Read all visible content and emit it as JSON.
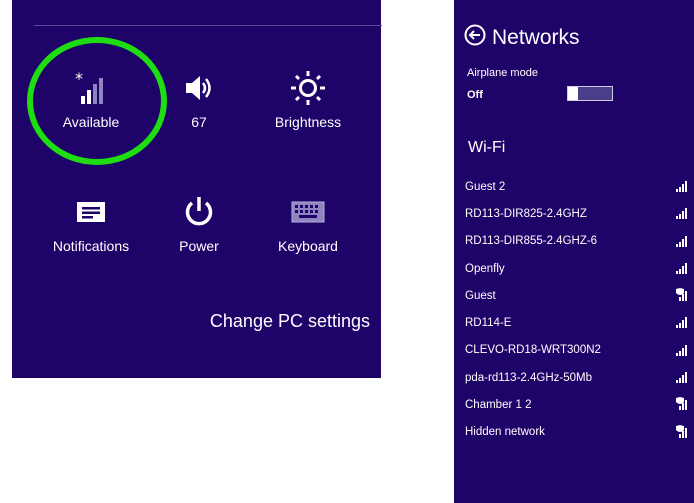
{
  "settings": {
    "quick_actions": [
      {
        "label": "Available",
        "icon": "wifi-signal-icon"
      },
      {
        "label": "67",
        "icon": "volume-icon"
      },
      {
        "label": "Brightness",
        "icon": "brightness-icon"
      },
      {
        "label": "Notifications",
        "icon": "notifications-icon"
      },
      {
        "label": "Power",
        "icon": "power-icon"
      },
      {
        "label": "Keyboard",
        "icon": "keyboard-icon"
      }
    ],
    "change_pc_settings": "Change PC settings",
    "highlight_color": "#1edd10"
  },
  "networks": {
    "title": "Networks",
    "airplane_mode": {
      "label": "Airplane mode",
      "state": "Off"
    },
    "wifi_heading": "Wi-Fi",
    "items": [
      {
        "name": "Guest 2",
        "secured": false
      },
      {
        "name": "RD113-DIR825-2.4GHZ",
        "secured": false
      },
      {
        "name": "RD113-DIR855-2.4GHZ-6",
        "secured": false
      },
      {
        "name": "Openfly",
        "secured": false
      },
      {
        "name": "Guest",
        "secured": true
      },
      {
        "name": "RD114-E",
        "secured": false
      },
      {
        "name": "CLEVO-RD18-WRT300N2",
        "secured": false
      },
      {
        "name": "pda-rd113-2.4GHz-50Mb",
        "secured": false
      },
      {
        "name": "Chamber 1 2",
        "secured": true
      },
      {
        "name": "Hidden network",
        "secured": true
      }
    ]
  },
  "colors": {
    "panel_bg": "#1e0468",
    "text": "#ffffff"
  }
}
